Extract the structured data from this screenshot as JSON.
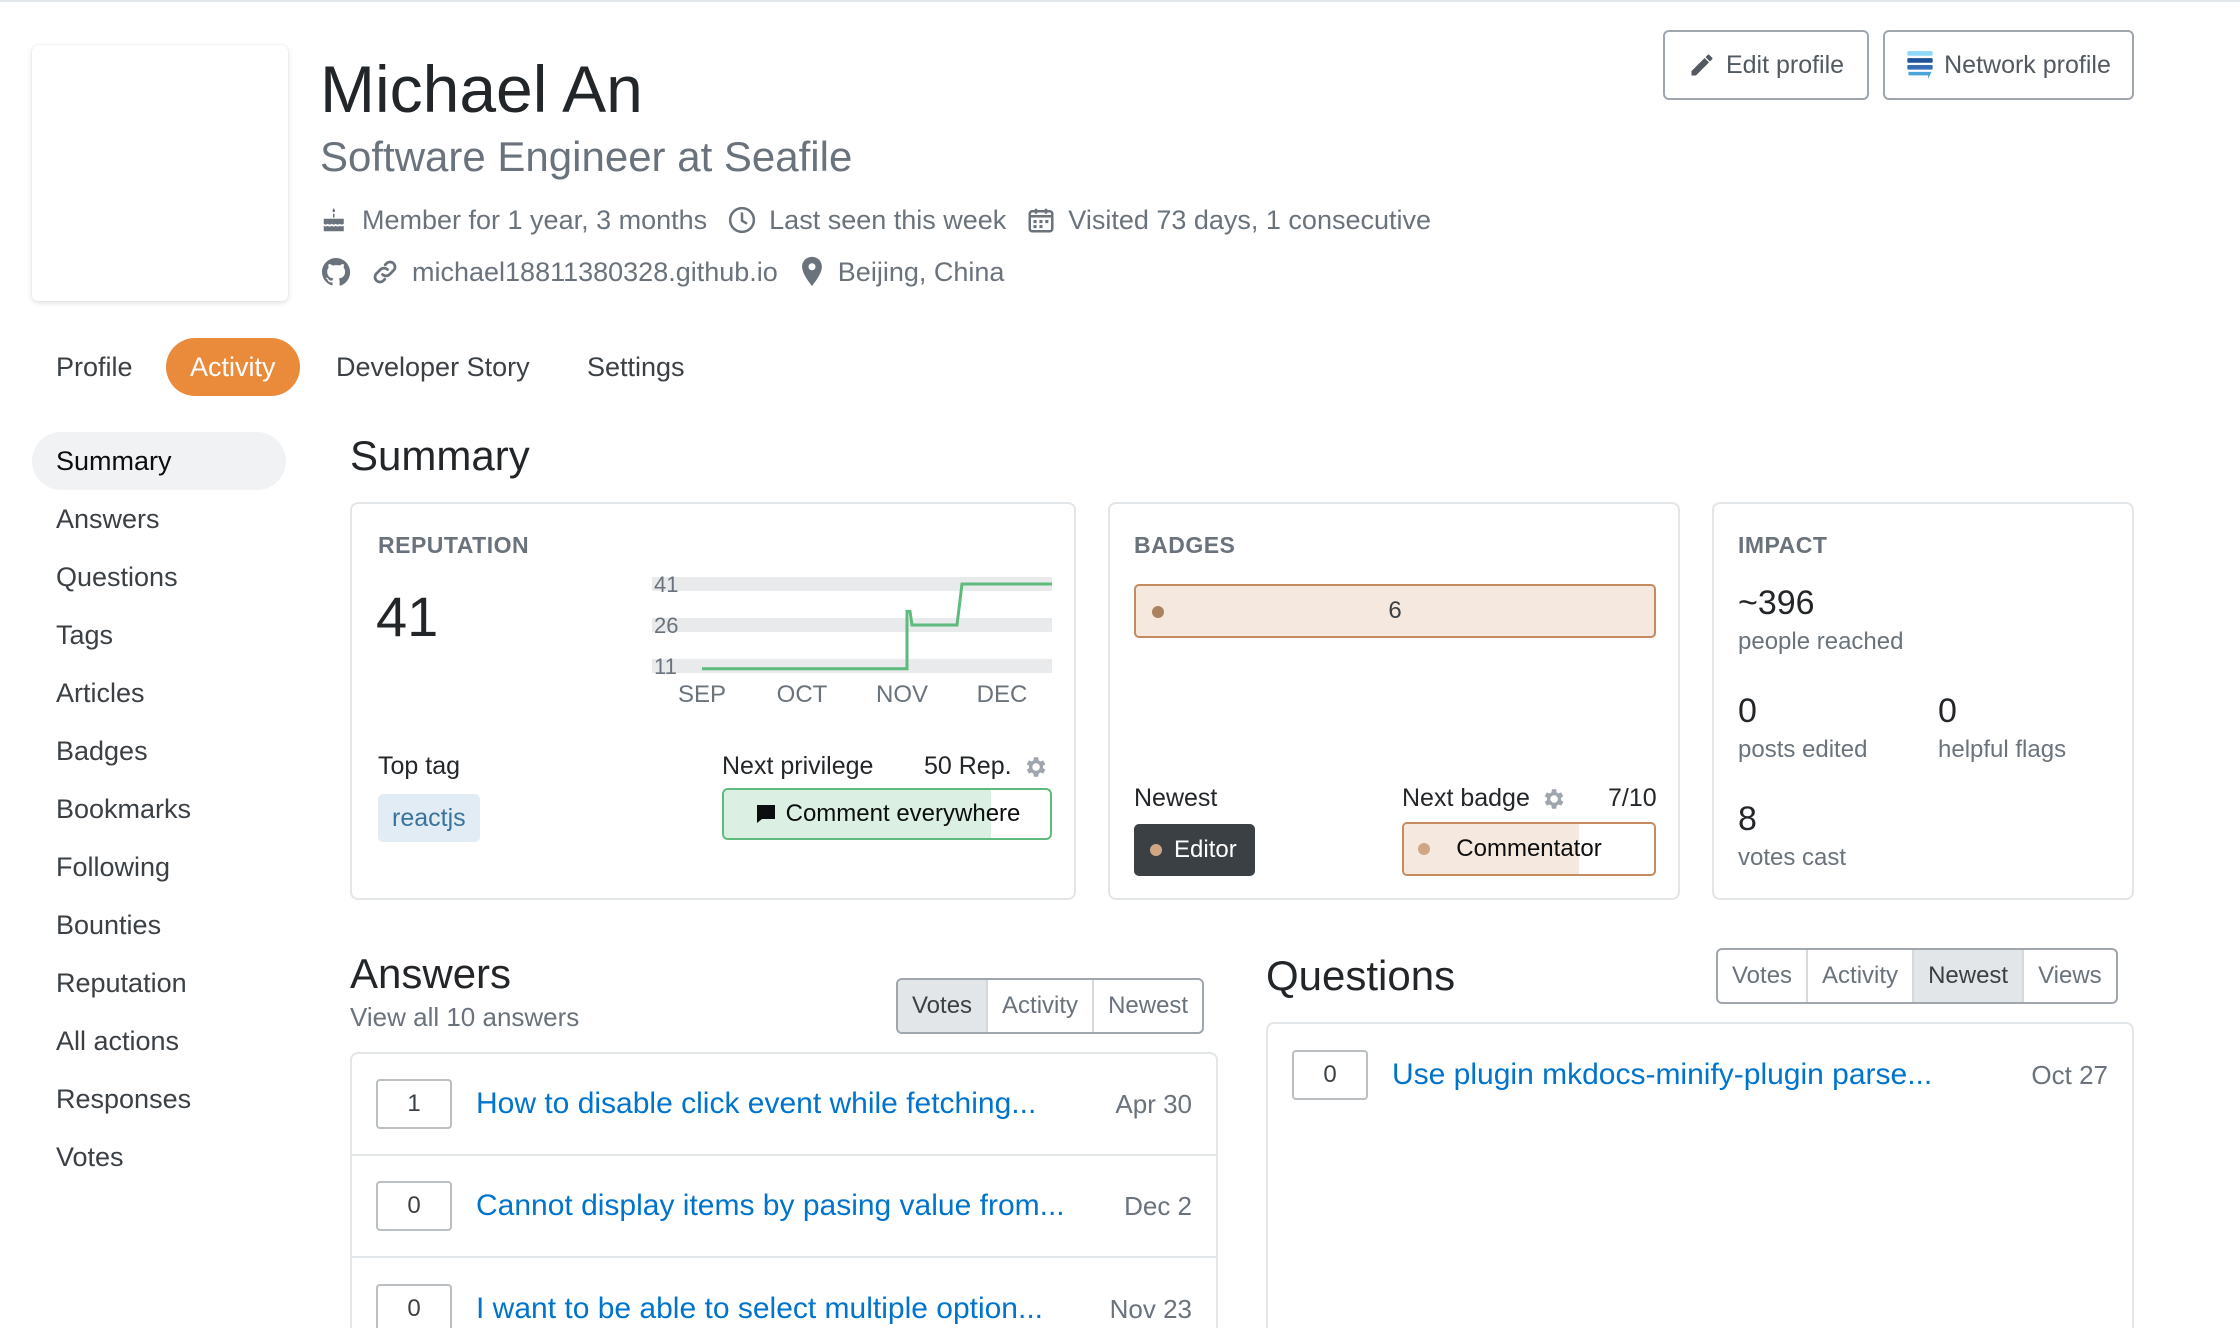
{
  "user": {
    "name": "Michael An",
    "title": "Software Engineer at Seafile",
    "member_for": "Member for 1 year, 3 months",
    "last_seen": "Last seen this week",
    "visited": "Visited 73 days, 1 consecutive",
    "website": "michael18811380328.github.io",
    "location": "Beijing, China"
  },
  "header_buttons": {
    "edit": "Edit profile",
    "network": "Network profile"
  },
  "top_tabs": [
    {
      "label": "Profile",
      "active": false
    },
    {
      "label": "Activity",
      "active": true
    },
    {
      "label": "Developer Story",
      "active": false
    },
    {
      "label": "Settings",
      "active": false
    }
  ],
  "sidebar": [
    "Summary",
    "Answers",
    "Questions",
    "Tags",
    "Articles",
    "Badges",
    "Bookmarks",
    "Following",
    "Bounties",
    "Reputation",
    "All actions",
    "Responses",
    "Votes"
  ],
  "summary": {
    "heading": "Summary",
    "reputation": {
      "label": "REPUTATION",
      "value": "41",
      "top_tag_label": "Top tag",
      "top_tag": "reactjs",
      "next_privilege_label": "Next privilege",
      "next_privilege_rep": "50 Rep.",
      "next_privilege_name": "Comment everywhere",
      "next_privilege_progress": 0.82
    },
    "badges": {
      "label": "BADGES",
      "bronze_count": "6",
      "newest_label": "Newest",
      "newest_badge": "Editor",
      "next_badge_label": "Next badge",
      "next_badge_progress": "7/10",
      "next_badge_name": "Commentator"
    },
    "impact": {
      "label": "IMPACT",
      "reached_value": "~396",
      "reached_label": "people reached",
      "edited_value": "0",
      "edited_label": "posts edited",
      "flags_value": "0",
      "flags_label": "helpful flags",
      "votes_value": "8",
      "votes_label": "votes cast"
    }
  },
  "chart_data": {
    "type": "line",
    "x_ticks": [
      "SEP",
      "OCT",
      "NOV",
      "DEC"
    ],
    "y_ticks": [
      41,
      26,
      11
    ],
    "ylim": [
      11,
      41
    ],
    "series": [
      {
        "values": [
          {
            "x": 0.0,
            "y": 10
          },
          {
            "x": 2.05,
            "y": 10
          },
          {
            "x": 2.05,
            "y": 31
          },
          {
            "x": 2.08,
            "y": 31
          },
          {
            "x": 2.1,
            "y": 26
          },
          {
            "x": 2.55,
            "y": 26
          },
          {
            "x": 2.6,
            "y": 41
          },
          {
            "x": 3.5,
            "y": 41
          }
        ]
      }
    ],
    "color": "#5eba7d"
  },
  "answers": {
    "heading": "Answers",
    "subtitle": "View all 10 answers",
    "sort_tabs": [
      {
        "label": "Votes",
        "on": true
      },
      {
        "label": "Activity",
        "on": false
      },
      {
        "label": "Newest",
        "on": false
      }
    ],
    "items": [
      {
        "score": "1",
        "title": "How to disable click event while fetching...",
        "date": "Apr 30"
      },
      {
        "score": "0",
        "title": "Cannot display items by pasing value from...",
        "date": "Dec 2"
      },
      {
        "score": "0",
        "title": "I want to be able to select multiple option...",
        "date": "Nov 23"
      }
    ]
  },
  "questions": {
    "heading": "Questions",
    "sort_tabs": [
      {
        "label": "Votes",
        "on": false
      },
      {
        "label": "Activity",
        "on": false
      },
      {
        "label": "Newest",
        "on": true
      },
      {
        "label": "Views",
        "on": false
      }
    ],
    "items": [
      {
        "score": "0",
        "title": "Use plugin mkdocs-minify-plugin parse...",
        "date": "Oct 27"
      }
    ]
  }
}
